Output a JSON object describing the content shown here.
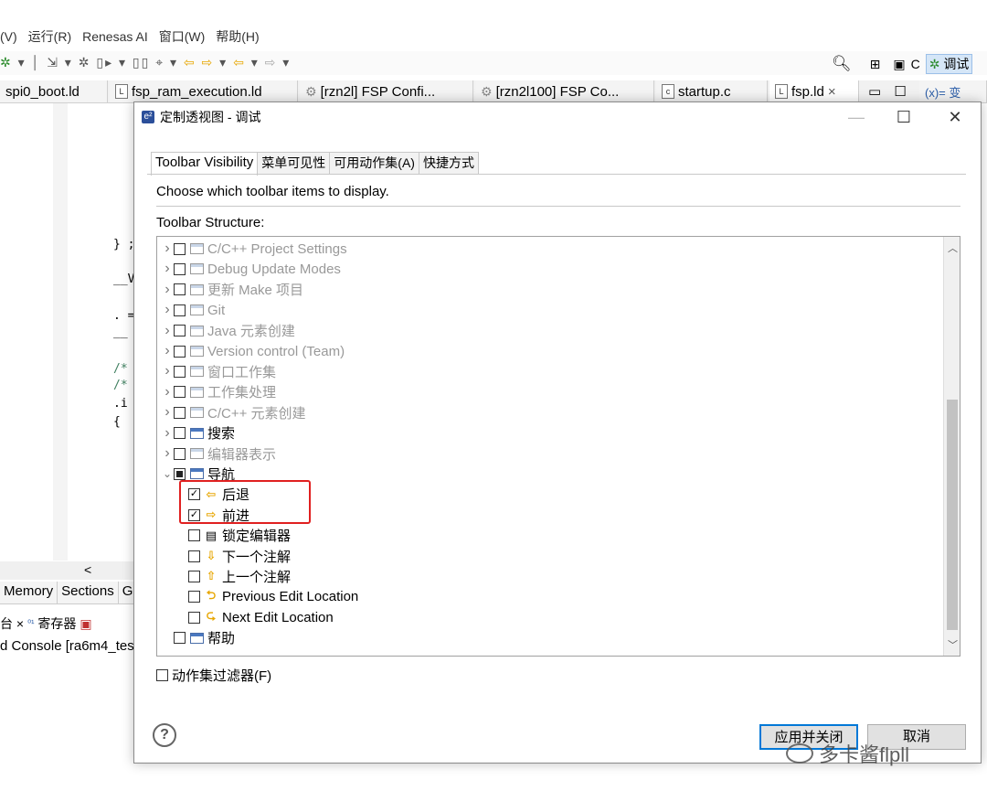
{
  "ide": {
    "menu": [
      "(V)",
      "运行(R)",
      "Renesas AI",
      "窗口(W)",
      "帮助(H)"
    ],
    "toolbar_right": {
      "c_label": "C",
      "debug_label": "调试"
    },
    "file_tabs": [
      {
        "label": "spi0_boot.ld",
        "icon": "L"
      },
      {
        "label": "fsp_ram_execution.ld",
        "icon": "L"
      },
      {
        "label": "[rzn2l] FSP Confi...",
        "icon": "gear"
      },
      {
        "label": "[rzn2l100] FSP Co...",
        "icon": "gear"
      },
      {
        "label": "startup.c",
        "icon": "c"
      },
      {
        "label": "fsp.ld",
        "icon": "L",
        "close": "×"
      }
    ],
    "side_tab": "(x)= 变",
    "code_lines": [
      "} ;",
      "__V",
      ". =",
      "__",
      "/*",
      "/*",
      ".i",
      "{"
    ],
    "hscroll_arrow": "<",
    "view_tabs": [
      "Memory",
      "Sections",
      "Gr"
    ],
    "view_tabs2": [
      "台 ×",
      "寄存器"
    ],
    "console": "d Console [ra6m4_tes"
  },
  "dialog": {
    "title": "定制透视图 - 调试",
    "tabs": [
      "Toolbar Visibility",
      "菜单可见性",
      "可用动作集(A)",
      "快捷方式"
    ],
    "active_tab": 0,
    "description": "Choose which toolbar items to display.",
    "structure_label": "Toolbar Structure:",
    "tree": [
      {
        "label": "C/C++ Project Settings",
        "level": 0,
        "expand": "collapsed",
        "check": "unchecked",
        "icon": "window",
        "dim": true
      },
      {
        "label": "Debug Update Modes",
        "level": 0,
        "expand": "collapsed",
        "check": "unchecked",
        "icon": "window",
        "dim": true
      },
      {
        "label": "更新 Make 项目",
        "level": 0,
        "expand": "collapsed",
        "check": "unchecked",
        "icon": "window",
        "dim": true
      },
      {
        "label": "Git",
        "level": 0,
        "expand": "collapsed",
        "check": "unchecked",
        "icon": "window",
        "dim": true
      },
      {
        "label": "Java 元素创建",
        "level": 0,
        "expand": "collapsed",
        "check": "unchecked",
        "icon": "window",
        "dim": true
      },
      {
        "label": "Version control (Team)",
        "level": 0,
        "expand": "collapsed",
        "check": "unchecked",
        "icon": "window",
        "dim": true
      },
      {
        "label": "窗口工作集",
        "level": 0,
        "expand": "collapsed",
        "check": "unchecked",
        "icon": "window",
        "dim": true
      },
      {
        "label": "工作集处理",
        "level": 0,
        "expand": "collapsed",
        "check": "unchecked",
        "icon": "window",
        "dim": true
      },
      {
        "label": "C/C++ 元素创建",
        "level": 0,
        "expand": "collapsed",
        "check": "unchecked",
        "icon": "window",
        "dim": true
      },
      {
        "label": "搜索",
        "level": 0,
        "expand": "collapsed",
        "check": "unchecked",
        "icon": "window-dark",
        "dim": false
      },
      {
        "label": "编辑器表示",
        "level": 0,
        "expand": "collapsed",
        "check": "unchecked",
        "icon": "window",
        "dim": true
      },
      {
        "label": "导航",
        "level": 0,
        "expand": "expanded",
        "check": "partial",
        "icon": "window-dark",
        "dim": false
      },
      {
        "label": "后退",
        "level": 1,
        "expand": "none",
        "check": "checked",
        "icon": "arrow-left",
        "dim": false
      },
      {
        "label": "前进",
        "level": 1,
        "expand": "none",
        "check": "checked",
        "icon": "arrow-right",
        "dim": false
      },
      {
        "label": "锁定编辑器",
        "level": 1,
        "expand": "none",
        "check": "unchecked",
        "icon": "lock-editor",
        "dim": false
      },
      {
        "label": "下一个注解",
        "level": 1,
        "expand": "none",
        "check": "unchecked",
        "icon": "arrow-down",
        "dim": false
      },
      {
        "label": "上一个注解",
        "level": 1,
        "expand": "none",
        "check": "unchecked",
        "icon": "arrow-up",
        "dim": false
      },
      {
        "label": "Previous Edit Location",
        "level": 1,
        "expand": "none",
        "check": "unchecked",
        "icon": "prev-edit",
        "dim": false
      },
      {
        "label": "Next Edit Location",
        "level": 1,
        "expand": "none",
        "check": "unchecked",
        "icon": "next-edit",
        "dim": false
      },
      {
        "label": "帮助",
        "level": 0,
        "expand": "none",
        "check": "unchecked",
        "icon": "window-dark",
        "dim": false
      }
    ],
    "filter_label": "动作集过滤器(F)",
    "filter_checked": false,
    "help_glyph": "?",
    "apply_close_label": "应用并关闭",
    "cancel_label": "取消"
  },
  "watermark": "多卡酱flpll",
  "colors": {
    "highlight_box": "#e02020",
    "default_button_border": "#0078d7",
    "arrow_icon": "#e7a600"
  }
}
